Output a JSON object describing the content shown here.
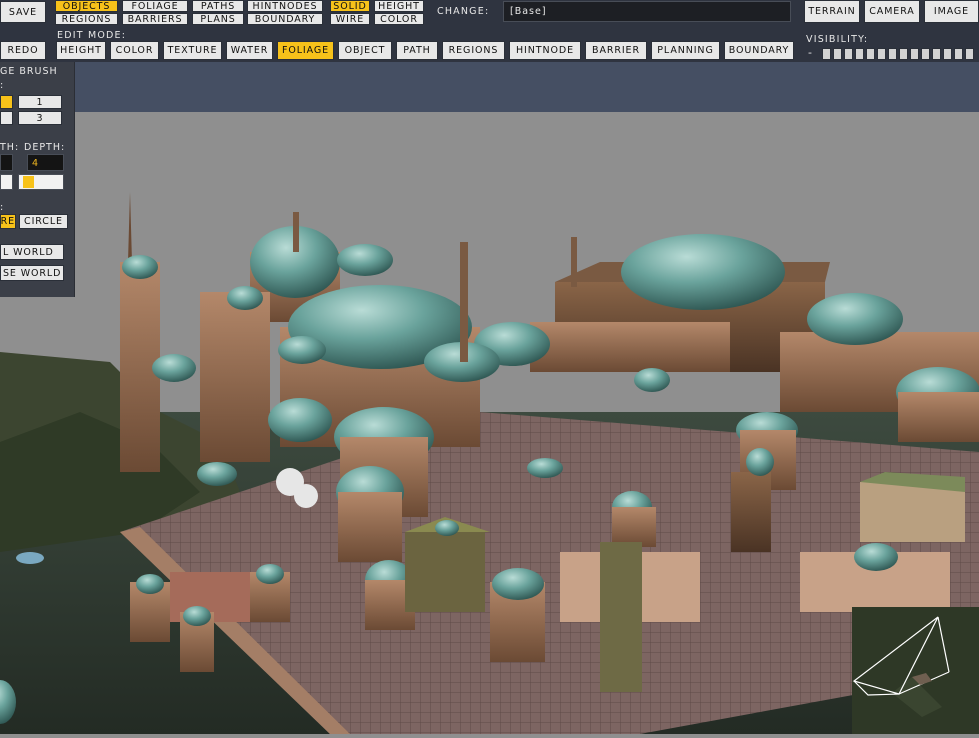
{
  "toolbar": {
    "save": "Save",
    "redo": "Redo",
    "view_toggles": {
      "objects": "Objects",
      "foliage": "Foliage",
      "paths": "Paths",
      "hintnodes": "HintNodes",
      "regions": "Regions",
      "barriers": "Barriers",
      "plans": "Plans",
      "boundary": "Boundary"
    },
    "render_toggles": {
      "solid": "Solid",
      "height": "Height",
      "wire": "Wire",
      "color": "Color"
    },
    "change_label": "Change:",
    "change_value": "[Base]",
    "right_buttons": {
      "terrain": "Terrain",
      "camera": "Camera",
      "image": "Image"
    },
    "edit_mode_label": "Edit Mode:",
    "edit_modes": {
      "height": "Height",
      "color": "Color",
      "texture": "Texture",
      "water": "Water",
      "foliage": "Foliage",
      "object": "Object",
      "path": "Path",
      "regions": "Regions",
      "hintnode": "HintNode",
      "barrier": "Barrier",
      "planning": "Planning",
      "boundary": "Boundary"
    },
    "active_edit_mode": "Foliage",
    "visibility_label": "Visibility:",
    "visibility_minus": "-",
    "visibility_level": 0.0
  },
  "brush_panel": {
    "title": "ge Brush",
    "size_label": ":",
    "sizes": [
      "1",
      "3"
    ],
    "width_label": "th:",
    "depth_label": "Depth:",
    "depth_value": "4",
    "shape_label": ":",
    "shape_square": "re",
    "shape_circle": "Circle",
    "fill_world": "l World",
    "erase_world": "se World"
  },
  "colors": {
    "accent": "#f7c21a",
    "toolbar_bg": "#2f3440",
    "button_bg": "#e8e8e8",
    "band_bg": "#454f63",
    "sky": "#8f8f8f"
  }
}
